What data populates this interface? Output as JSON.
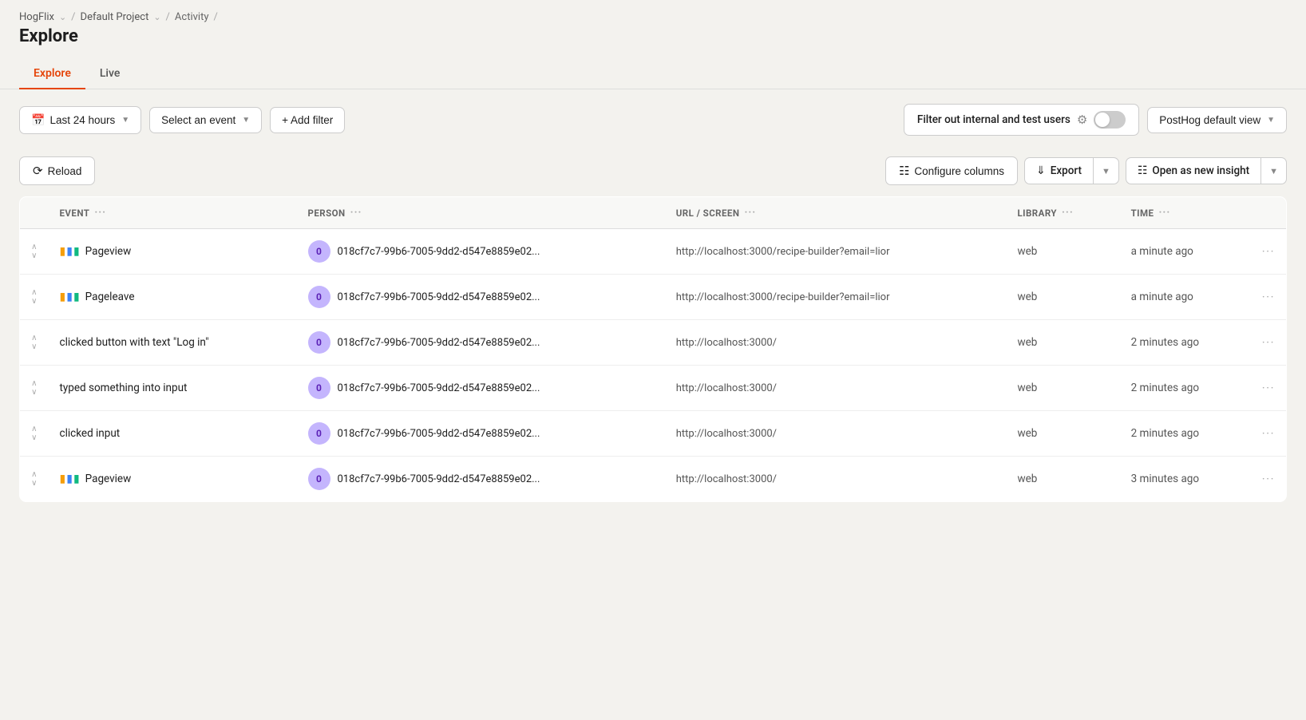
{
  "breadcrumb": {
    "items": [
      {
        "label": "HogFlix",
        "has_chevron": true
      },
      {
        "label": "Default Project",
        "has_chevron": true
      },
      {
        "label": "Activity",
        "has_chevron": false
      },
      {
        "label": "",
        "has_chevron": false
      }
    ]
  },
  "page_title": "Explore",
  "tabs": [
    {
      "label": "Explore",
      "active": true
    },
    {
      "label": "Live",
      "active": false
    }
  ],
  "toolbar": {
    "time_filter_label": "Last 24 hours",
    "event_filter_label": "Select an event",
    "add_filter_label": "+ Add filter",
    "filter_toggle_label": "Filter out internal and test users",
    "view_selector_label": "PostHog default view"
  },
  "action_bar": {
    "reload_label": "Reload",
    "configure_columns_label": "Configure columns",
    "export_label": "Export",
    "open_insight_label": "Open as new insight"
  },
  "table": {
    "columns": [
      {
        "label": "EVENT"
      },
      {
        "label": "PERSON"
      },
      {
        "label": "URL / SCREEN"
      },
      {
        "label": "LIBRARY"
      },
      {
        "label": "TIME"
      }
    ],
    "rows": [
      {
        "expand": true,
        "event": "Pageview",
        "event_has_icon": true,
        "person_avatar": "0",
        "person_id": "018cf7c7-99b6-7005-9dd2-d547e8859e02...",
        "url": "http://localhost:3000/recipe-builder?email=lior",
        "library": "web",
        "time": "a minute ago"
      },
      {
        "expand": true,
        "event": "Pageleave",
        "event_has_icon": true,
        "person_avatar": "0",
        "person_id": "018cf7c7-99b6-7005-9dd2-d547e8859e02...",
        "url": "http://localhost:3000/recipe-builder?email=lior",
        "library": "web",
        "time": "a minute ago"
      },
      {
        "expand": true,
        "event": "clicked button with text \"Log in\"",
        "event_has_icon": false,
        "person_avatar": "0",
        "person_id": "018cf7c7-99b6-7005-9dd2-d547e8859e02...",
        "url": "http://localhost:3000/",
        "library": "web",
        "time": "2 minutes ago"
      },
      {
        "expand": true,
        "event": "typed something into input",
        "event_has_icon": false,
        "person_avatar": "0",
        "person_id": "018cf7c7-99b6-7005-9dd2-d547e8859e02...",
        "url": "http://localhost:3000/",
        "library": "web",
        "time": "2 minutes ago"
      },
      {
        "expand": true,
        "event": "clicked input",
        "event_has_icon": false,
        "person_avatar": "0",
        "person_id": "018cf7c7-99b6-7005-9dd2-d547e8859e02...",
        "url": "http://localhost:3000/",
        "library": "web",
        "time": "2 minutes ago"
      },
      {
        "expand": true,
        "event": "Pageview",
        "event_has_icon": true,
        "person_avatar": "0",
        "person_id": "018cf7c7-99b6-7005-9dd2-d547e8859e02...",
        "url": "http://localhost:3000/",
        "library": "web",
        "time": "3 minutes ago"
      }
    ]
  }
}
